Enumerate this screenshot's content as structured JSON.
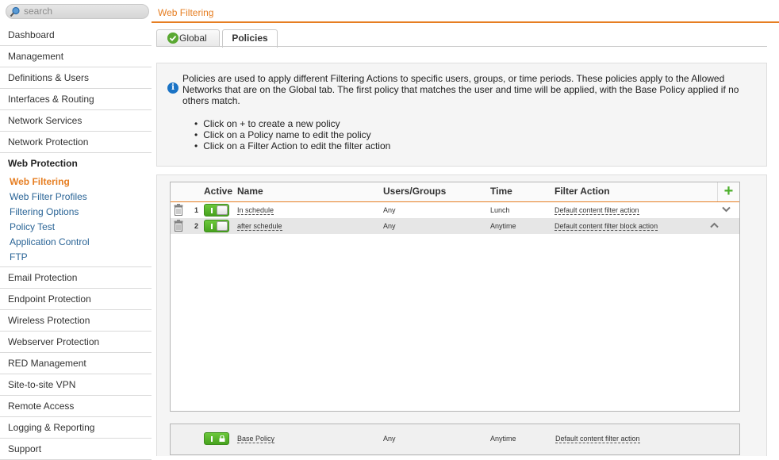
{
  "search": {
    "placeholder": "search"
  },
  "sidebar": {
    "items_top": [
      {
        "key": "dashboard",
        "label": "Dashboard"
      },
      {
        "key": "management",
        "label": "Management"
      },
      {
        "key": "definitions-users",
        "label": "Definitions & Users"
      },
      {
        "key": "interfaces-routing",
        "label": "Interfaces & Routing"
      },
      {
        "key": "network-services",
        "label": "Network Services"
      },
      {
        "key": "network-protection",
        "label": "Network Protection"
      }
    ],
    "section": "Web Protection",
    "sub_items": [
      {
        "key": "web-filtering",
        "label": "Web Filtering",
        "active": true
      },
      {
        "key": "web-filter-profiles",
        "label": "Web Filter Profiles"
      },
      {
        "key": "filtering-options",
        "label": "Filtering Options"
      },
      {
        "key": "policy-test",
        "label": "Policy Test"
      },
      {
        "key": "application-control",
        "label": "Application Control"
      },
      {
        "key": "ftp",
        "label": "FTP"
      }
    ],
    "items_bottom": [
      {
        "key": "email-protection",
        "label": "Email Protection"
      },
      {
        "key": "endpoint-protection",
        "label": "Endpoint Protection"
      },
      {
        "key": "wireless-protection",
        "label": "Wireless Protection"
      },
      {
        "key": "webserver-protection",
        "label": "Webserver Protection"
      },
      {
        "key": "red-management",
        "label": "RED Management"
      },
      {
        "key": "site-to-site-vpn",
        "label": "Site-to-site VPN"
      },
      {
        "key": "remote-access",
        "label": "Remote Access"
      },
      {
        "key": "logging-reporting",
        "label": "Logging & Reporting"
      },
      {
        "key": "support",
        "label": "Support"
      }
    ]
  },
  "header": {
    "title": "Web Filtering"
  },
  "tabs": {
    "global": "Global",
    "policies": "Policies"
  },
  "info": {
    "text": "Policies are used to apply different Filtering Actions to specific users, groups, or time periods. These policies apply to the Allowed Networks that are on the Global tab. The first policy that matches the user and time will be applied, with the Base Policy applied if no others match.",
    "bullets": [
      "Click on + to create a new policy",
      "Click on a Policy name to edit the policy",
      "Click on a Filter Action to edit the filter action"
    ]
  },
  "table": {
    "headers": {
      "active": "Active",
      "name": "Name",
      "users": "Users/Groups",
      "time": "Time",
      "action": "Filter Action"
    },
    "add_symbol": "+",
    "rows": [
      {
        "num": "1",
        "name": "In schedule",
        "users": "Any",
        "time": "Lunch",
        "action": "Default content filter action",
        "chevron": "down",
        "active": true
      },
      {
        "num": "2",
        "name": "after schedule",
        "users": "Any",
        "time": "Anytime",
        "action": "Default content filter block action",
        "chevron": "up",
        "active": true
      }
    ]
  },
  "base_policy": {
    "name": "Base Policy",
    "users": "Any",
    "time": "Anytime",
    "action": "Default content filter action"
  },
  "colors": {
    "accent": "#e67e22",
    "link": "#2a6496",
    "toggle_on": "#56b228"
  },
  "icons": [
    "search-icon",
    "check-icon",
    "info-icon",
    "plus-icon",
    "trash-icon",
    "chevron-down-icon",
    "chevron-up-icon",
    "lock-icon"
  ]
}
